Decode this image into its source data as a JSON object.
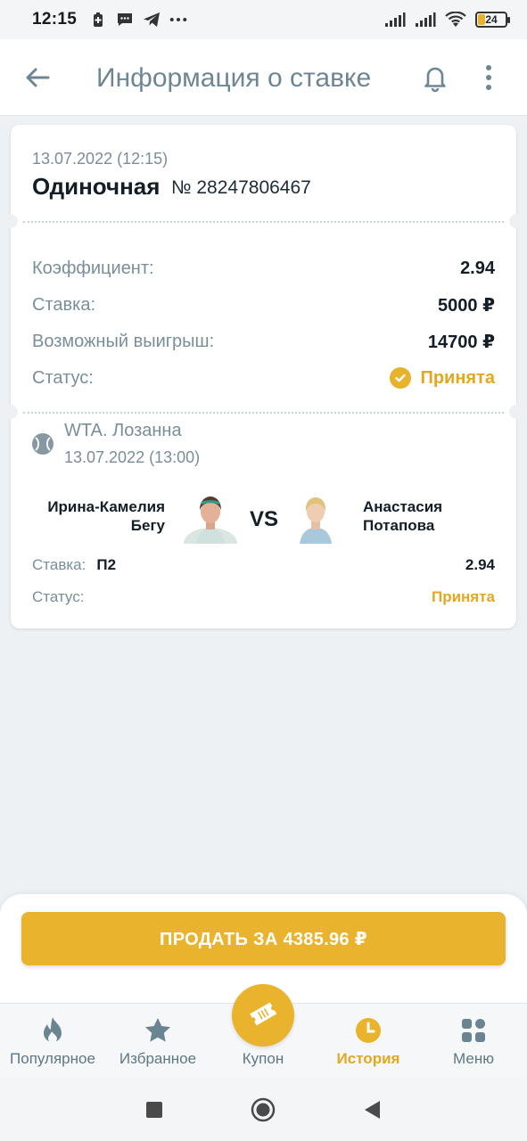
{
  "status_bar": {
    "time": "12:15",
    "battery": "24",
    "icons": [
      "battery-saver-icon",
      "message-icon",
      "telegram-icon",
      "more-dots-icon",
      "signal-icon",
      "signal-icon",
      "wifi-icon",
      "battery-icon"
    ]
  },
  "header": {
    "title": "Информация о ставке",
    "icons": [
      "back-arrow-icon",
      "bell-icon",
      "more-vert-icon"
    ]
  },
  "bet": {
    "date": "13.07.2022 (12:15)",
    "type": "Одиночная",
    "number": "№ 28247806467",
    "rows": [
      {
        "label": "Коэффициент:",
        "value": "2.94"
      },
      {
        "label": "Ставка:",
        "value": "5000 ₽"
      },
      {
        "label": "Возможный выигрыш:",
        "value": "14700 ₽"
      },
      {
        "label": "Статус:",
        "value": "Принята"
      }
    ]
  },
  "event": {
    "league": "WTA. Лозанна",
    "date": "13.07.2022 (13:00)",
    "player1": "Ирина-Камелия Бегу",
    "player2": "Анастасия Потапова",
    "vs": "VS",
    "stake_label": "Ставка:",
    "pick": "П2",
    "odds": "2.94",
    "status_label": "Статус:",
    "status": "Принята"
  },
  "sell_button": "ПРОДАТЬ ЗА 4385.96 ₽",
  "nav": [
    {
      "label": "Популярное",
      "icon": "flame-icon"
    },
    {
      "label": "Избранное",
      "icon": "star-icon"
    },
    {
      "label": "Купон",
      "icon": "ticket-icon"
    },
    {
      "label": "История",
      "icon": "clock-icon",
      "active": true
    },
    {
      "label": "Меню",
      "icon": "grid-icon"
    }
  ],
  "colors": {
    "accent": "#e9b32d",
    "muted_text": "#7a8e99",
    "title_text": "#6e8693",
    "background": "#eef1f4"
  }
}
